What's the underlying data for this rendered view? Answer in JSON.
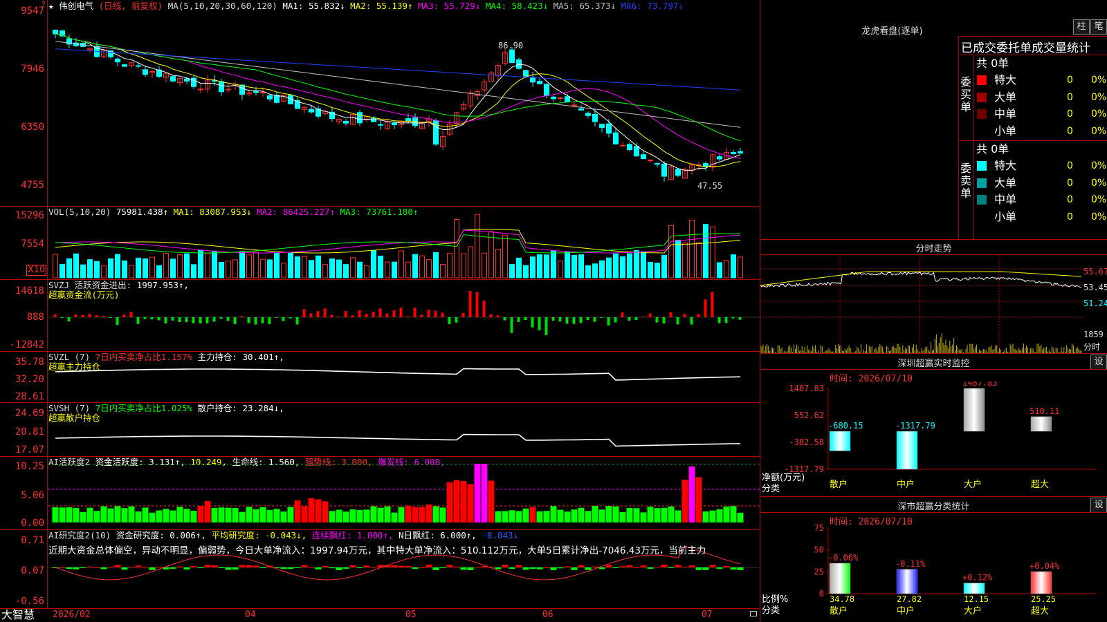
{
  "stock": {
    "name": "伟创电气",
    "mode": "(日线, 前复权)"
  },
  "price_panel": {
    "ma_label": "MA(5,10,20,30,60,120)",
    "ma": [
      {
        "label": "MA1:",
        "value": "55.832↓",
        "color": "#ffffff"
      },
      {
        "label": "MA2:",
        "value": "55.139↑",
        "color": "#ffff00"
      },
      {
        "label": "MA3:",
        "value": "55.729↓",
        "color": "#ff00ff"
      },
      {
        "label": "MA4:",
        "value": "58.423↓",
        "color": "#00ff00"
      },
      {
        "label": "MA5:",
        "value": "65.373↓",
        "color": "#c0c0c0"
      },
      {
        "label": "MA6:",
        "value": "73.797↓",
        "color": "#2040ff"
      }
    ],
    "yticks": [
      "9547",
      "7946",
      "6350",
      "4755"
    ],
    "high_label": "86.90",
    "low_label": "47.55"
  },
  "vol_panel": {
    "label": "VOL(5,10,20)",
    "value": "75981.438↑",
    "ma": [
      {
        "label": "MA1:",
        "value": "83087.953↓",
        "color": "#ffff00"
      },
      {
        "label": "MA2:",
        "value": "86425.227↑",
        "color": "#ff00ff"
      },
      {
        "label": "MA3:",
        "value": "73761.180↑",
        "color": "#00ff00"
      }
    ],
    "yticks": [
      "15296",
      "7554"
    ],
    "unit": "X10"
  },
  "svzj_panel": {
    "label": "SVZJ  活跃资金进出:",
    "value": "1997.953↑,",
    "subtitle": "超赢资金流(万元)",
    "yticks": [
      "14618",
      "888",
      "-12842"
    ]
  },
  "svzl_panel": {
    "label": "SVZL (7)",
    "ratio": "7日内买卖净占比1.157%",
    "hold_label": "主力持仓:",
    "hold_value": "30.401↑,",
    "subtitle": "超赢主力持仓",
    "yticks": [
      "35.78",
      "32.20",
      "28.61"
    ]
  },
  "svsh_panel": {
    "label": "SVSH (7)",
    "ratio": "7日内买卖净占比1.025%",
    "hold_label": "散户持仓:",
    "hold_value": "23.284↓,",
    "subtitle": "超赢散户持仓",
    "yticks": [
      "24.69",
      "20.81",
      "17.07"
    ]
  },
  "ai_active_panel": {
    "label": "AI活跃度2",
    "parts": [
      {
        "text": "资金活跃度: 3.131↑,",
        "color": "#ffffff"
      },
      {
        "text": "10.249,",
        "color": "#ffff00"
      },
      {
        "text": "生命线: 1.560,",
        "color": "#ffffff"
      },
      {
        "text": "强势线: 3.000,",
        "color": "#ff3030"
      },
      {
        "text": "爆发线: 6.000,",
        "color": "#ff00ff"
      }
    ],
    "yticks": [
      "10.25",
      "5.06",
      "0.00"
    ]
  },
  "ai_research_panel": {
    "label": "AI研究度2(10)",
    "parts": [
      {
        "text": "资金研究度: 0.006↑,",
        "color": "#ffffff"
      },
      {
        "text": "平均研究度: -0.043↓,",
        "color": "#ffff00"
      },
      {
        "text": "连续飘红: 1.000↑,",
        "color": "#ff00ff"
      },
      {
        "text": "N日飘红: 6.000↑,",
        "color": "#ffffff"
      },
      {
        "text": "-0.043↓",
        "color": "#2060ff"
      }
    ],
    "comment": "近期大资金总体偏空，异动不明显，偏弱势，今日大单净流入：1997.94万元，其中特大单净流入：510.112万元，大单5日累计净出-7046.43万元，当前主力",
    "yticks": [
      "0.71",
      "0.07",
      "-0.56"
    ]
  },
  "xaxis": {
    "brand": "大智慧",
    "labels": [
      "2026/02",
      "04",
      "05",
      "06",
      "07"
    ]
  },
  "dragon_panel": {
    "title": "龙虎看盘(逐单)",
    "btn1": "柱",
    "btn2": "笔",
    "stat_title": "已成交委托单成交量统计",
    "buy": {
      "side_label": "委买单",
      "total": "共 0单",
      "rows": [
        {
          "label": "特大",
          "count": "0",
          "pct": "0%",
          "color": "#ff0000"
        },
        {
          "label": "大单",
          "count": "0",
          "pct": "0%",
          "color": "#a00000"
        },
        {
          "label": "中单",
          "count": "0",
          "pct": "0%",
          "color": "#700000"
        },
        {
          "label": "小单",
          "count": "0",
          "pct": "0%",
          "color": ""
        }
      ]
    },
    "sell": {
      "side_label": "委卖单",
      "total": "共 0单",
      "rows": [
        {
          "label": "特大",
          "count": "0",
          "pct": "0%",
          "color": "#00ffff"
        },
        {
          "label": "大单",
          "count": "0",
          "pct": "0%",
          "color": "#00a0a0"
        },
        {
          "label": "中单",
          "count": "0",
          "pct": "0%",
          "color": "#008080"
        },
        {
          "label": "小单",
          "count": "0",
          "pct": "0%",
          "color": ""
        }
      ]
    }
  },
  "intraday_panel": {
    "title": "分时走势",
    "yticks": [
      "55.67",
      "53.45",
      "51.24",
      "1859",
      "分时"
    ]
  },
  "sz_monitor": {
    "title": "深圳超赢实时监控",
    "btn": "设",
    "time": "时间: 2026/07/10",
    "yticks": [
      "1487.83",
      "552.62",
      "-382.58",
      "-1317.79"
    ],
    "axis_label": "净额(万元)",
    "cat_label": "分类",
    "categories": [
      "散户",
      "中户",
      "大户",
      "超大"
    ],
    "values": [
      -680.15,
      -1317.79,
      1487.83,
      510.11
    ],
    "value_labels": [
      "-680.15",
      "-1317.79",
      "1487.83",
      "510.11"
    ]
  },
  "sz_class": {
    "title": "深市超赢分类统计",
    "btn": "设",
    "time": "时间: 2026/07/10",
    "yticks": [
      "75",
      "50",
      "25",
      "0"
    ],
    "axis_label": "比例%",
    "cat_label": "分类",
    "categories": [
      "散户",
      "中户",
      "大户",
      "超大"
    ],
    "values": [
      34.78,
      27.82,
      12.15,
      25.25
    ],
    "value_labels": [
      "34.78",
      "27.82",
      "12.15",
      "25.25"
    ],
    "changes": [
      "-0.06%",
      "-0.11%",
      "+0.12%",
      "+0.04%"
    ]
  },
  "chart_data": [
    {
      "type": "line",
      "title": "伟创电气 (日线, 前复权)",
      "x": [
        "2026/02",
        "04",
        "05",
        "06",
        "07"
      ],
      "ylim": [
        47.55,
        95.47
      ],
      "series": [
        {
          "name": "MA1",
          "last": 55.832
        },
        {
          "name": "MA2",
          "last": 55.139
        },
        {
          "name": "MA3",
          "last": 55.729
        },
        {
          "name": "MA4",
          "last": 58.423
        },
        {
          "name": "MA5",
          "last": 65.373
        },
        {
          "name": "MA6",
          "last": 73.797
        }
      ],
      "annotations": [
        "86.90",
        "47.55"
      ]
    },
    {
      "type": "bar",
      "title": "深圳超赢实时监控",
      "categories": [
        "散户",
        "中户",
        "大户",
        "超大"
      ],
      "values": [
        -680.15,
        -1317.79,
        1487.83,
        510.11
      ],
      "ylabel": "净额(万元)",
      "ylim": [
        -1317.79,
        1487.83
      ]
    },
    {
      "type": "bar",
      "title": "深市超赢分类统计",
      "categories": [
        "散户",
        "中户",
        "大户",
        "超大"
      ],
      "values": [
        34.78,
        27.82,
        12.15,
        25.25
      ],
      "ylabel": "比例%",
      "ylim": [
        0,
        75
      ]
    }
  ]
}
